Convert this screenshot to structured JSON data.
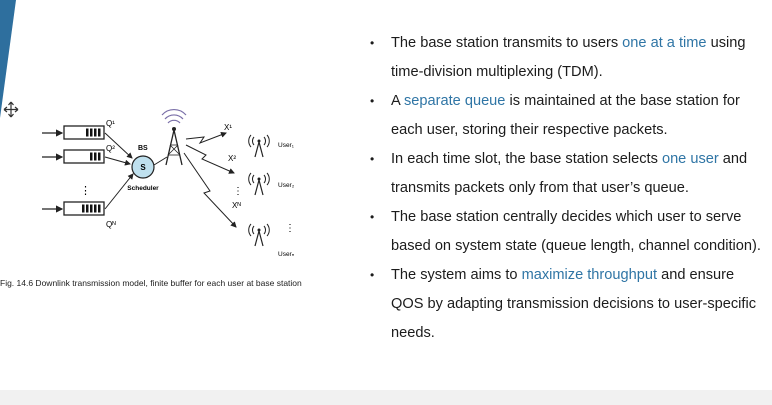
{
  "caption": "Fig. 14.6 Downlink transmission model, finite buffer for each user at base station",
  "diagram": {
    "queues": [
      "Q¹",
      "Q²",
      "Qᴺ"
    ],
    "bs_label": "BS",
    "scheduler_symbol": "S",
    "scheduler_label": "Scheduler",
    "channels": [
      "X¹",
      "X²",
      "Xᴺ"
    ],
    "users": [
      "User₁",
      "User₂",
      "Userₙ"
    ],
    "ellipsis": "⋮"
  },
  "bullets": [
    {
      "parts": [
        {
          "t": "The base station transmits to users "
        },
        {
          "t": "one at a time",
          "hl": true
        },
        {
          "t": " using time-division multiplexing (TDM)."
        }
      ]
    },
    {
      "parts": [
        {
          "t": "A "
        },
        {
          "t": "separate queue",
          "hl": true
        },
        {
          "t": " is maintained at the base station for each user, storing their respective packets."
        }
      ]
    },
    {
      "parts": [
        {
          "t": "In each time slot, the base station selects "
        },
        {
          "t": "one user",
          "hl": true
        },
        {
          "t": " and transmits packets only from that user’s queue."
        }
      ]
    },
    {
      "parts": [
        {
          "t": "The base station centrally decides which user to serve based on system state (queue length, channel condition)."
        }
      ]
    },
    {
      "parts": [
        {
          "t": "The system aims to "
        },
        {
          "t": "maximize throughput",
          "hl": true
        },
        {
          "t": " and ensure QOS by adapting transmission decisions to user-specific needs."
        }
      ]
    }
  ],
  "colors": {
    "accent": "#2f75a5",
    "corner": "#2e6f9e",
    "scheduler_fill": "#bfe0ee"
  },
  "icons": [
    "move-cursor-icon",
    "antenna-tower-icon",
    "mobile-user-icon"
  ]
}
